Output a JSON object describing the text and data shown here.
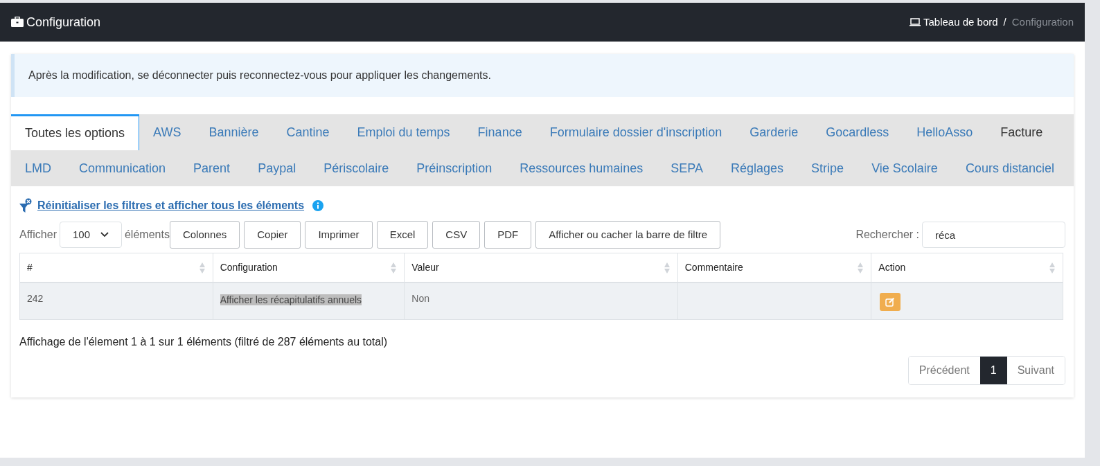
{
  "header": {
    "title": "Configuration",
    "breadcrumb": [
      {
        "label": "Tableau de bord",
        "current": false
      },
      {
        "label": "Configuration",
        "current": true
      }
    ],
    "separator": "/"
  },
  "alert": "Après la modification, se déconnecter puis reconnectez-vous pour appliquer les changements.",
  "tabs": [
    {
      "label": "Toutes les options",
      "selected": true,
      "hovered": false
    },
    {
      "label": "AWS",
      "selected": false,
      "hovered": false
    },
    {
      "label": "Bannière",
      "selected": false,
      "hovered": false
    },
    {
      "label": "Cantine",
      "selected": false,
      "hovered": false
    },
    {
      "label": "Emploi du temps",
      "selected": false,
      "hovered": false
    },
    {
      "label": "Finance",
      "selected": false,
      "hovered": false
    },
    {
      "label": "Formulaire dossier d'inscription",
      "selected": false,
      "hovered": false
    },
    {
      "label": "Garderie",
      "selected": false,
      "hovered": false
    },
    {
      "label": "Gocardless",
      "selected": false,
      "hovered": false
    },
    {
      "label": "HelloAsso",
      "selected": false,
      "hovered": false
    },
    {
      "label": "Facture",
      "selected": false,
      "hovered": true
    },
    {
      "label": "LMD",
      "selected": false,
      "hovered": false
    },
    {
      "label": "Communication",
      "selected": false,
      "hovered": false
    },
    {
      "label": "Parent",
      "selected": false,
      "hovered": false
    },
    {
      "label": "Paypal",
      "selected": false,
      "hovered": false
    },
    {
      "label": "Périscolaire",
      "selected": false,
      "hovered": false
    },
    {
      "label": "Préinscription",
      "selected": false,
      "hovered": false
    },
    {
      "label": "Ressources humaines",
      "selected": false,
      "hovered": false
    },
    {
      "label": "SEPA",
      "selected": false,
      "hovered": false
    },
    {
      "label": "Réglages",
      "selected": false,
      "hovered": false
    },
    {
      "label": "Stripe",
      "selected": false,
      "hovered": false
    },
    {
      "label": "Vie Scolaire",
      "selected": false,
      "hovered": false
    },
    {
      "label": "Cours distanciel",
      "selected": false,
      "hovered": false
    }
  ],
  "reset_filters_link": "Réinitialiser les filtres et afficher tous les éléments",
  "length_control": {
    "prefix": "Afficher",
    "value": "100",
    "suffix": "éléments"
  },
  "buttons": [
    "Colonnes",
    "Copier",
    "Imprimer",
    "Excel",
    "CSV",
    "PDF",
    "Afficher ou cacher la barre de filtre"
  ],
  "search": {
    "label": "Rechercher :",
    "value": "réca"
  },
  "table": {
    "columns": [
      "#",
      "Configuration",
      "Valeur",
      "Commentaire",
      "Action"
    ],
    "rows": [
      {
        "id": "242",
        "configuration": "Afficher les récapitulatifs annuels",
        "configuration_highlighted": true,
        "valeur": "Non",
        "commentaire": ""
      }
    ]
  },
  "info": "Affichage de l'élement 1 à 1 sur 1 éléments (filtré de 287 éléments au total)",
  "pagination": [
    {
      "label": "Précédent",
      "selected": false
    },
    {
      "label": "1",
      "selected": true
    },
    {
      "label": "Suivant",
      "selected": false
    }
  ]
}
